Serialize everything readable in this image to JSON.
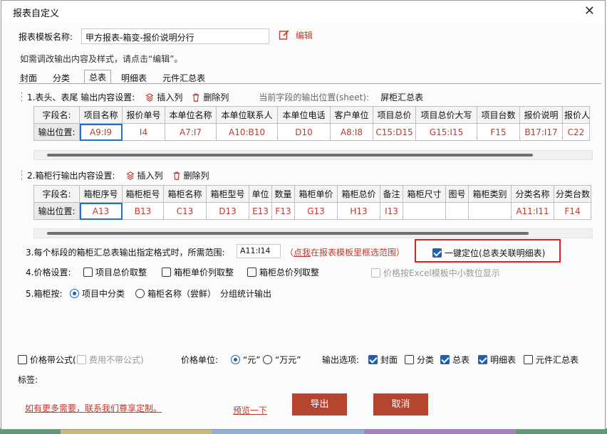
{
  "dialog": {
    "title": "报表自定义"
  },
  "template": {
    "name_label": "报表模板名称:",
    "name_value": "甲方报表-箱变-报价说明分行",
    "edit_label": "编辑",
    "hint": "如需调改输出内容及样式，请点击“编辑”。"
  },
  "tabs": [
    {
      "label": "封面"
    },
    {
      "label": "分类"
    },
    {
      "label": "总表"
    },
    {
      "label": "明细表"
    },
    {
      "label": "元件汇总表"
    }
  ],
  "section1": {
    "title": "1.表头、表尾 输出内容设置:",
    "insert_col": "插入列",
    "delete_col": "删除列",
    "position_label": "当前字段的输出位置(sheet):",
    "position_value": "屏柜汇总表",
    "row_field": "字段名:",
    "row_output": "输出位置:",
    "headers": [
      "项目名称",
      "报价单号",
      "本单位名称",
      "本单位联系人",
      "本单位电话",
      "客户单位",
      "项目总价",
      "项目总价大写",
      "项目台数",
      "报价说明",
      "报价人"
    ],
    "values": [
      "A9:I9",
      "I4",
      "A7:I7",
      "A10:B10",
      "D10",
      "A8:I8",
      "C15:D15",
      "G15:I15",
      "F15",
      "B17:I17",
      "C22"
    ]
  },
  "section2": {
    "title": "2.箱柜行输出内容设置:",
    "insert_col": "插入列",
    "delete_col": "删除列",
    "row_field": "字段名:",
    "row_output": "输出位置:",
    "headers": [
      "箱柜序号",
      "箱柜柜号",
      "箱柜名称",
      "箱柜型号",
      "单位",
      "数量",
      "箱柜单价",
      "箱柜总价",
      "备注",
      "箱柜尺寸",
      "图号",
      "箱柜类别",
      "分类名称",
      "分类台数"
    ],
    "values": [
      "A13",
      "B13",
      "C13",
      "D13",
      "E13",
      "F13",
      "G13",
      "H13",
      "I13",
      "",
      "",
      "",
      "A11:I11",
      "F14"
    ]
  },
  "section3": {
    "label": "3.每个标段的箱柜汇总表输出指定格式时，所需范围:",
    "range_value": "A11:I14",
    "paren_open": "（",
    "click_link": "点我",
    "select_text": "在报表模板里框选范围",
    "paren_close": "）",
    "one_key_label": "一键定位(总表关联明细表)"
  },
  "section4": {
    "label": "4.价格设置:",
    "opt1": "项目总价取整",
    "opt2": "箱柜单价列取整",
    "opt3": "箱柜总价列取整",
    "opt4": "价格按Excel模板中小数位显示"
  },
  "section5": {
    "label": "5.箱柜按:",
    "radio1": "项目中分类",
    "radio2": "箱柜名称（尝鲜）",
    "suffix": "分组统计输出"
  },
  "bottom": {
    "price_formula": "价格带公式(",
    "fee_formula": "费用不带公式)",
    "unit_label": "价格单位:",
    "unit_yuan": "“元”",
    "unit_wanyuan": "“万元”",
    "output_label": "输出选项:",
    "out_cover": "封面",
    "out_class": "分类",
    "out_total": "总表",
    "out_detail": "明细表",
    "out_parts": "元件汇总表",
    "tag_label": "标签:",
    "custom_link": "如有更多需要，联系我们尊享定制。",
    "preview_link": "预览一下",
    "export_btn": "导出",
    "cancel_btn": "取消"
  },
  "colors": {
    "accent_red": "#b5452e",
    "link_red": "#c0392b",
    "check_blue": "#1e5fb3",
    "highlight_frame": "#e02020"
  },
  "state": {
    "active_tab": "总表",
    "one_key_checked": true,
    "price_unit": "元",
    "group_by": "项目中分类",
    "outputs_checked": [
      "封面",
      "总表",
      "明细表"
    ]
  }
}
